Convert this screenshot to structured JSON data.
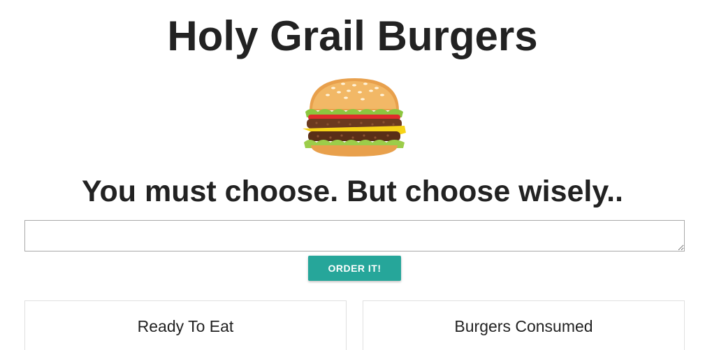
{
  "header": {
    "title": "Holy Grail Burgers"
  },
  "hero": {
    "image_icon": "burger-icon",
    "tagline": "You must choose. But choose wisely.."
  },
  "order_form": {
    "input_value": "",
    "input_placeholder": "",
    "submit_label": "ORDER IT!"
  },
  "panels": {
    "ready": {
      "title": "Ready To Eat"
    },
    "consumed": {
      "title": "Burgers Consumed"
    }
  },
  "colors": {
    "accent": "#26a69a",
    "text": "#222222",
    "panel_border": "#e0e0e0"
  }
}
